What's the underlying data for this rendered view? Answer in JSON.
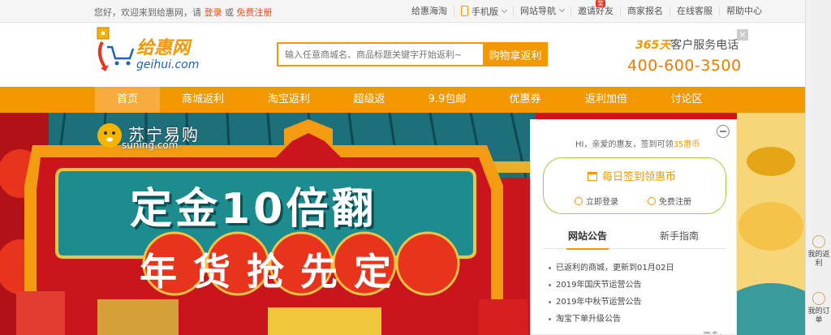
{
  "topbar": {
    "greeting": "您好，欢迎来到给惠网，请",
    "login": "登录",
    "or": "或",
    "register": "免费注册",
    "links": {
      "haitao": "给惠海淘",
      "mobile": "手机版",
      "sitenav": "网站导航",
      "invite": "邀请好友",
      "invite_badge": "奖",
      "merchant": "商家报名",
      "service": "在线客服",
      "help": "帮助中心"
    }
  },
  "logo": {
    "cn": "给惠网",
    "en": "geihui.com"
  },
  "search": {
    "placeholder": "输入任意商城名、商品标题关键字开始返利~",
    "button": "购物拿返利"
  },
  "service": {
    "days": "365天",
    "label": "客户服务电话",
    "phone": "400-600-3500"
  },
  "nav": [
    "首页",
    "商城返利",
    "淘宝返利",
    "超级返",
    "9.9包邮",
    "优惠券",
    "返利加倍",
    "讨论区"
  ],
  "banner": {
    "brand_cn": "苏宁易购",
    "brand_en": "suning.com",
    "headline": "定金10倍翻",
    "slogan": "年货抢先定"
  },
  "panel": {
    "hi": "HI，亲爱的惠友，签到可领",
    "coins": "35惠币",
    "sign": "每日签到领惠币",
    "login": "立即登录",
    "register": "免费注册",
    "tab_notice": "网站公告",
    "tab_guide": "新手指南",
    "notices": [
      "已返利的商城，更新到01月02日",
      "2019年国庆节运营公告",
      "2019年中秋节运营公告",
      "淘宝下单升级公告"
    ],
    "more": "更多>"
  },
  "sidebar": {
    "rebate": "我的返利",
    "orders": "我的订单"
  },
  "colors": {
    "accent": "#f39800",
    "banner_red": "#c9151b",
    "teal": "#1d8c8f"
  }
}
